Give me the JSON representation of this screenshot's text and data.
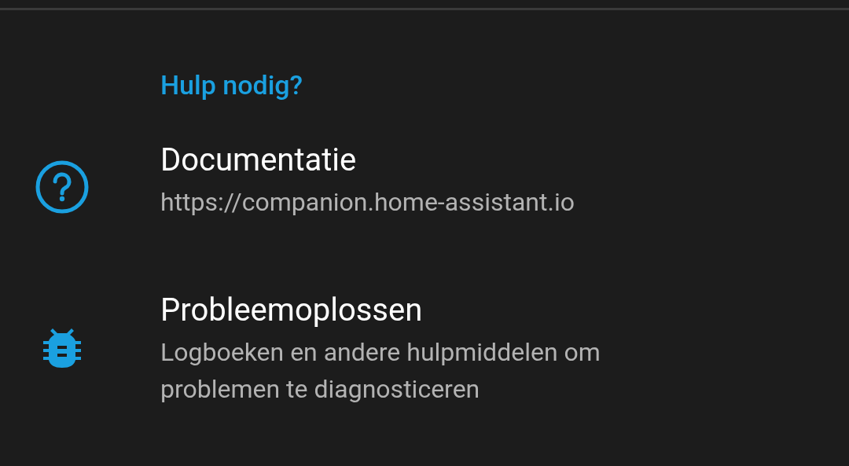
{
  "section": {
    "title": "Hulp nodig?"
  },
  "items": [
    {
      "kind": "help",
      "title": "Documentatie",
      "subtitle": "https://companion.home-assistant.io"
    },
    {
      "kind": "bug",
      "title": "Probleemoplossen",
      "subtitle": "Logboeken en andere hulpmiddelen om problemen te diagnosticeren"
    }
  ]
}
